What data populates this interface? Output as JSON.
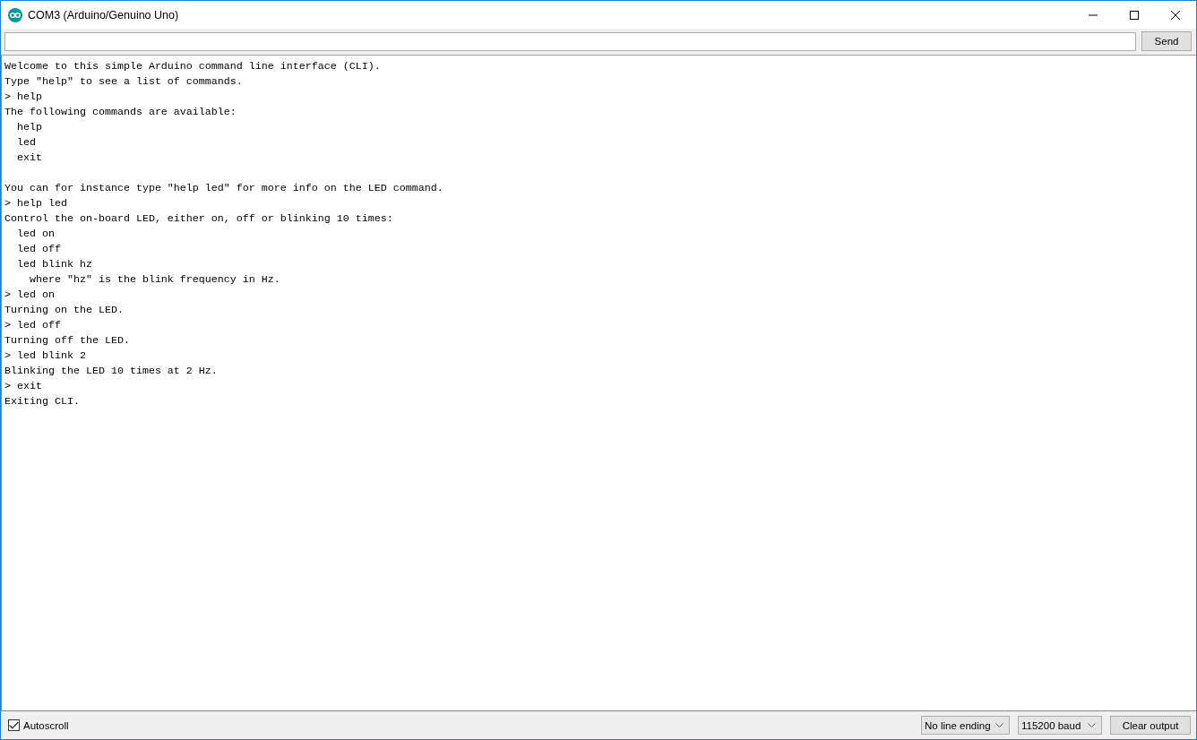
{
  "window": {
    "title": "COM3 (Arduino/Genuino Uno)"
  },
  "send_button": "Send",
  "output_paragraphs": [
    {
      "lines": [
        "Welcome to this simple Arduino command line interface (CLI).",
        "Type \"help\" to see a list of commands.",
        "> help",
        "The following commands are available:",
        "  help",
        "  led",
        "  exit"
      ]
    },
    {
      "lines": [
        "You can for instance type \"help led\" for more info on the LED command.",
        "> help led",
        "Control the on-board LED, either on, off or blinking 10 times:",
        "  led on",
        "  led off",
        "  led blink hz",
        "    where \"hz\" is the blink frequency in Hz.",
        "> led on",
        "Turning on the LED.",
        "> led off",
        "Turning off the LED.",
        "> led blink 2",
        "Blinking the LED 10 times at 2 Hz.",
        "> exit",
        "Exiting CLI."
      ]
    }
  ],
  "status_bar": {
    "autoscroll": {
      "label": "Autoscroll",
      "checked": true
    },
    "line_ending": "No line ending",
    "baud_rate": "115200 baud",
    "clear_button": "Clear output"
  }
}
